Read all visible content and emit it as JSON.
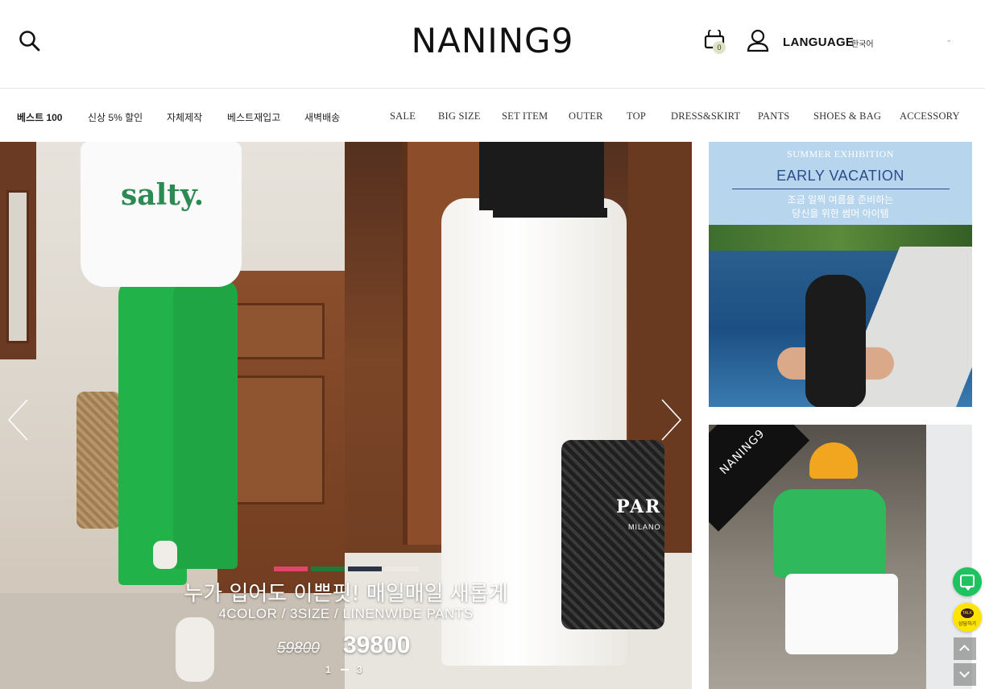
{
  "header": {
    "logo": "NANING9",
    "cart_count": "0",
    "language_label": "LANGUAGE",
    "language_value": "한국어",
    "language_caret": "⌄"
  },
  "nav": {
    "korean_items": [
      "베스트 100",
      "신상 5% 할인",
      "자체제작",
      "베스트재입고",
      "새벽배송"
    ],
    "category_items": [
      "SALE",
      "BIG SIZE",
      "SET ITEM",
      "OUTER",
      "TOP",
      "DRESS&SKIRT",
      "PANTS",
      "SHOES & BAG",
      "ACCESSORY"
    ]
  },
  "hero": {
    "shirt_print": "salty.",
    "bag_print": "PAR",
    "bag_print_sub": "MILANO",
    "dot_colors": [
      "#e0456b",
      "#1f7a3a",
      "#2c3447",
      "#efe9df"
    ],
    "title": "누가 입어도 이쁜핏! 매일매일 새롭게",
    "subtitle": "4COLOR / 3SIZE / LINENWIDE PANTS",
    "price_old": "59800",
    "price_new": "39800",
    "page_current": "1",
    "page_total": "3"
  },
  "banner1": {
    "eyebrow": "SUMMER EXHIBITION",
    "title": "EARLY VACATION",
    "line1": "조금 일찍 여름을 준비하는",
    "line2": "당신을 위한 썸머 아이템"
  },
  "banner2": {
    "corner_label": "NANING9"
  },
  "floating": {
    "kakao_bubble": "TALK",
    "kakao_label": "상담하기"
  },
  "colors": {
    "green_talk": "#1ec35f",
    "kakao_yellow": "#fee500",
    "banner_blue": "#2b4c8a"
  },
  "icons": [
    "search-icon",
    "cart-icon",
    "user-icon",
    "chevron-left-icon",
    "chevron-right-icon",
    "chat-icon",
    "kakao-icon",
    "arrow-up-icon",
    "arrow-down-icon"
  ]
}
